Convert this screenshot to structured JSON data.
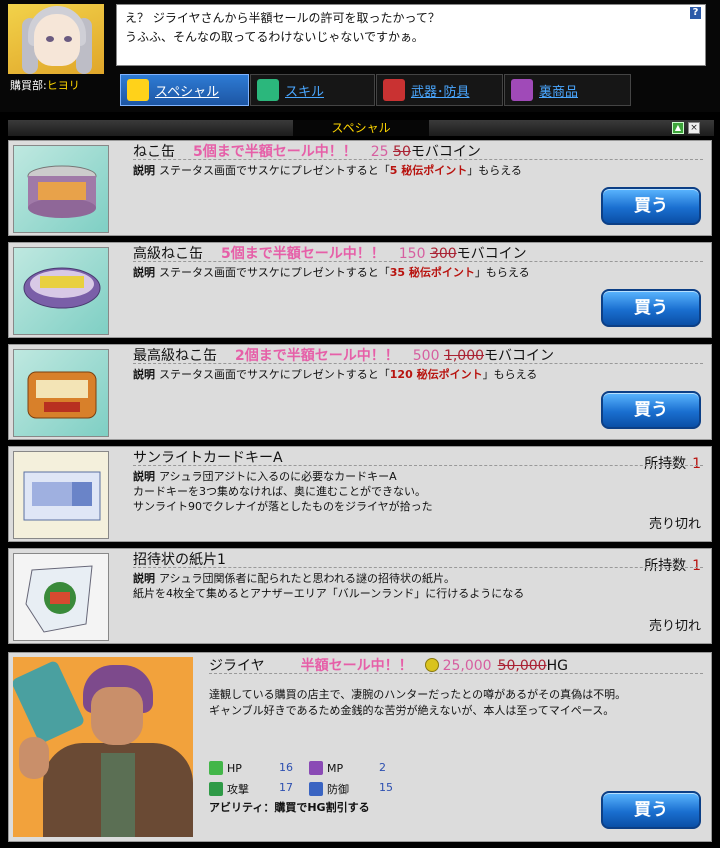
{
  "header": {
    "shop_label": "購買部:",
    "shopkeeper_name": "ヒヨリ",
    "dialog_line1": "え？ ジライヤさんから半額セールの許可を取ったかって？",
    "dialog_line2": "うふふ、そんなの取ってるわけないじゃないですかぁ。",
    "help_label": "?"
  },
  "tabs": [
    {
      "label": "スペシャル",
      "icon": "special-icon",
      "active": true
    },
    {
      "label": "スキル",
      "icon": "skill-icon",
      "active": false
    },
    {
      "label": "武器･防具",
      "icon": "weapon-icon",
      "active": false
    },
    {
      "label": "裏商品",
      "icon": "secret-goods-icon",
      "active": false
    }
  ],
  "section": {
    "title": "スペシャル",
    "scroll_top_icon": "▲",
    "close_icon": "×"
  },
  "items": [
    {
      "name": "ねこ缶",
      "sale": "5個まで半額セール中！！",
      "price": "25",
      "old_price": "50",
      "unit": "モバコイン",
      "desc_label": "説明",
      "desc_pre": "ステータス画面でサスケにプレゼントすると「",
      "desc_point": "5 秘伝ポイント",
      "desc_post": "」もらえる",
      "button": "買う"
    },
    {
      "name": "高級ねこ缶",
      "sale": "5個まで半額セール中！！",
      "price": "150",
      "old_price": "300",
      "unit": "モバコイン",
      "desc_label": "説明",
      "desc_pre": "ステータス画面でサスケにプレゼントすると「",
      "desc_point": "35 秘伝ポイント",
      "desc_post": "」もらえる",
      "button": "買う"
    },
    {
      "name": "最高級ねこ缶",
      "sale": "2個まで半額セール中！！",
      "price": "500",
      "old_price": "1,000",
      "unit": "モバコイン",
      "desc_label": "説明",
      "desc_pre": "ステータス画面でサスケにプレゼントすると「",
      "desc_point": "120 秘伝ポイント",
      "desc_post": "」もらえる",
      "button": "買う"
    },
    {
      "name": "サンライトカードキーA",
      "owned_label": "所持数",
      "owned": "1",
      "desc_label": "説明",
      "desc_line1": "アシュラ団アジトに入るのに必要なカードキーA",
      "desc_line2": "カードキーを3つ集めなければ、奥に進むことができない。",
      "desc_line3": "サンライト90でクレナイが落としたものをジライヤが拾った",
      "status": "売り切れ"
    },
    {
      "name": "招待状の紙片1",
      "owned_label": "所持数",
      "owned": "1",
      "desc_label": "説明",
      "desc_line1": "アシュラ団関係者に配られたと思われる謎の招待状の紙片。",
      "desc_line2": "紙片を4枚全て集めるとアナザーエリア「バルーンランド」に行けるようになる",
      "status": "売り切れ"
    }
  ],
  "partner": {
    "name": "ジライヤ",
    "sale": "半額セール中！！",
    "price": "25,000",
    "old_price": "50,000",
    "unit": "HG",
    "desc_line1": "達観している購買の店主で、凄腕のハンターだったとの噂があるがその真偽は不明。",
    "desc_line2": "ギャンブル好きであるため金銭的な苦労が絶えないが、本人は至ってマイペース。",
    "stats": {
      "hp_label": "HP",
      "hp": "16",
      "mp_label": "MP",
      "mp": "2",
      "atk_label": "攻撃",
      "atk": "17",
      "def_label": "防御",
      "def": "15"
    },
    "ability": "アビリティ：購買でHG割引する",
    "button": "買う"
  }
}
